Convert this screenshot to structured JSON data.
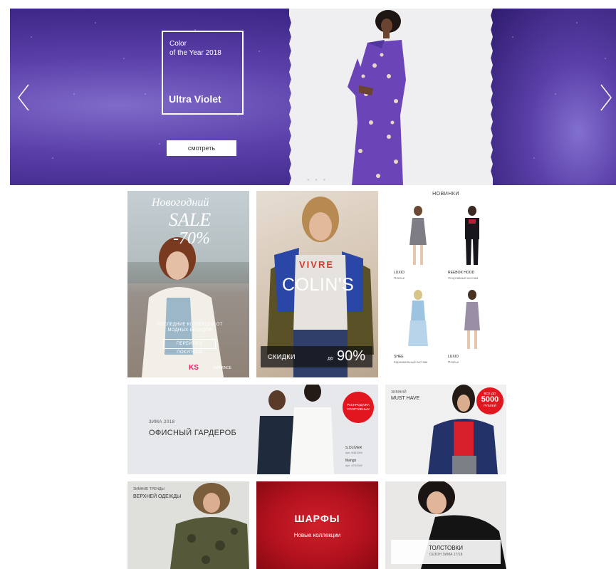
{
  "hero": {
    "small_title": "Color\nof the Year 2018",
    "big_title": "Ultra Violet",
    "button_label": "смотреть"
  },
  "tiles": {
    "sale": {
      "script": "Новогодний",
      "sale": "SALE",
      "percent": "-70%",
      "caption": "ПОСЛЕДНИЕ КОЛЛЕКЦИИ ОТ МОДНЫХ БРЕНДОВ",
      "button": "ПЕРЕЙТИ К ПОКУПКАМ",
      "brand_a": "KS",
      "brand_b": "AMBIENCE"
    },
    "colins": {
      "brand": "COLIN'S",
      "shirt": "VIVRE",
      "discount_label": "СКИДКИ",
      "discount_prefix": "до",
      "discount_value": "90%"
    },
    "novelties": {
      "title": "НОВИНКИ",
      "items": [
        {
          "brand": "LUXIO",
          "type": "Платье"
        },
        {
          "brand": "REEBOK HOOD",
          "type": "Спортивный костюм"
        },
        {
          "brand": "SHEE",
          "type": "Карнавальный костюм"
        },
        {
          "brand": "LUXIO",
          "type": "Платье"
        }
      ]
    },
    "office": {
      "season": "ЗИМА 2018",
      "title": "ОФИСНЫЙ ГАРДЕРОБ",
      "badge": "РАСПРОДАЖА СПОРТИВНЫХ",
      "brand1": "S.OLIVER",
      "art1": "Арт. 8401994",
      "brand2": "Mango",
      "art2": "Арт. 4701942"
    },
    "musthave": {
      "season": "ЗИМНИЙ",
      "title": "MUST HAVE",
      "badge_top": "ВСЕ ДО",
      "badge_value": "5000",
      "badge_unit": "РУБЛЕЙ"
    },
    "outer": {
      "season": "ЗИМНИЕ ТРЕНДЫ",
      "title": "ВЕРХНЕЙ ОДЕЖДЫ"
    },
    "scarves": {
      "title": "ШАРФЫ",
      "subtitle": "Новые коллекции"
    },
    "hoodies": {
      "title": "ТОЛСТОВКИ",
      "subtitle": "СЕЗОН ЗИМА 17/18"
    }
  },
  "colors": {
    "violet": "#5a3fa8",
    "sale_pink": "#e91e63",
    "badge_red": "#e2161f",
    "scarf_red": "#b3121e"
  }
}
